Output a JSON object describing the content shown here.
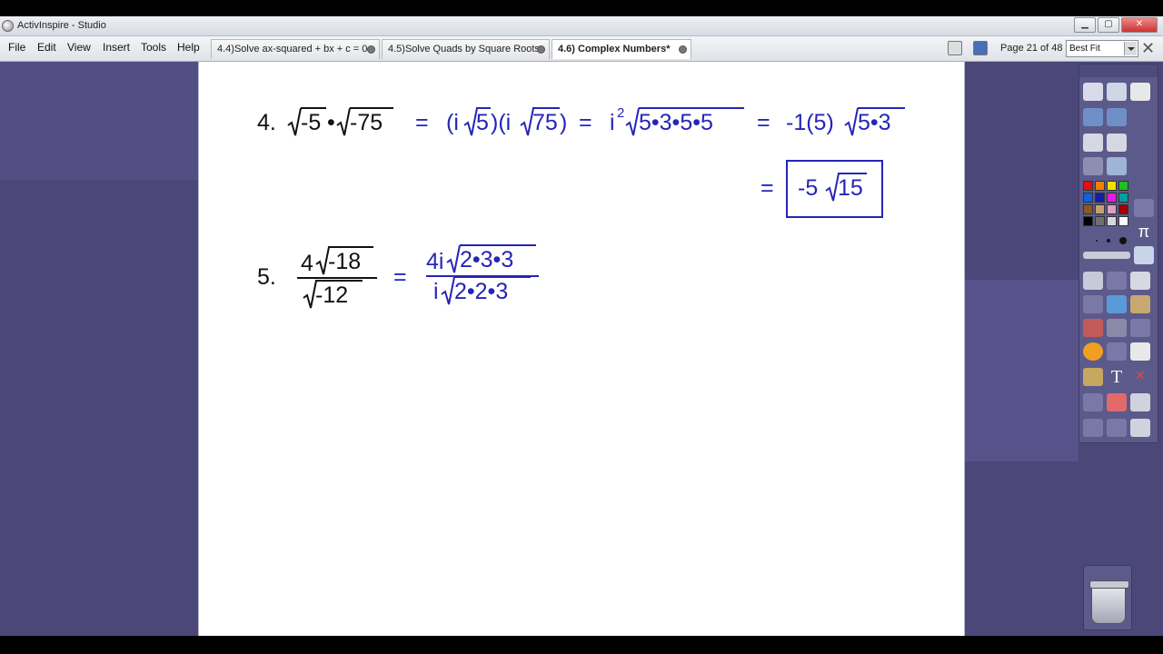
{
  "window": {
    "title": "ActivInspire - Studio"
  },
  "menu": [
    "File",
    "Edit",
    "View",
    "Insert",
    "Tools",
    "Help"
  ],
  "tabs": [
    {
      "label": "4.4)Solve ax-squared + bx + c = 0",
      "active": false
    },
    {
      "label": "4.5)Solve Quads by Square Roots",
      "active": false
    },
    {
      "label": "4.6) Complex Numbers*",
      "active": true
    }
  ],
  "page_indicator": "Page 21 of 48",
  "zoom": "Best Fit",
  "flipchart": {
    "problem4": {
      "number": "4.",
      "r1": "-5",
      "dot": "•",
      "r2": "-75",
      "eq1": "=",
      "p1_open": "(i",
      "p1_rad": "5",
      "p1_close": ")(i",
      "p2_rad": "75",
      "p2_close": ")",
      "eq2": "=",
      "i_base": "i",
      "i_exp": "2",
      "r3": "5•3•5•5",
      "eq3": "=",
      "coef": "-1(5)",
      "r4": "5•3",
      "eq4": "=",
      "answer_coef": "-5",
      "answer_rad": "15"
    },
    "problem5": {
      "number": "5.",
      "num_coef": "4",
      "num_rad": "-18",
      "den_rad": "-12",
      "eq": "=",
      "rhs_num_coef": "4i",
      "rhs_num_rad": "2•3•3",
      "rhs_den_coef": "i",
      "rhs_den_rad": "2•2•3"
    }
  },
  "colors": {
    "ink_black": "#111111",
    "ink_blue": "#2525b8",
    "workspace": "#4b4879"
  },
  "toolbox_palette": [
    "#e01010",
    "#f08000",
    "#f0e000",
    "#20c020",
    "#1060e0",
    "#1020a0",
    "#e020e0",
    "#00a0a0",
    "#8a5a20",
    "#c8a070",
    "#e0a0c0",
    "#a00000",
    "#000000",
    "#707070",
    "#d8d8d8",
    "#ffffff"
  ]
}
